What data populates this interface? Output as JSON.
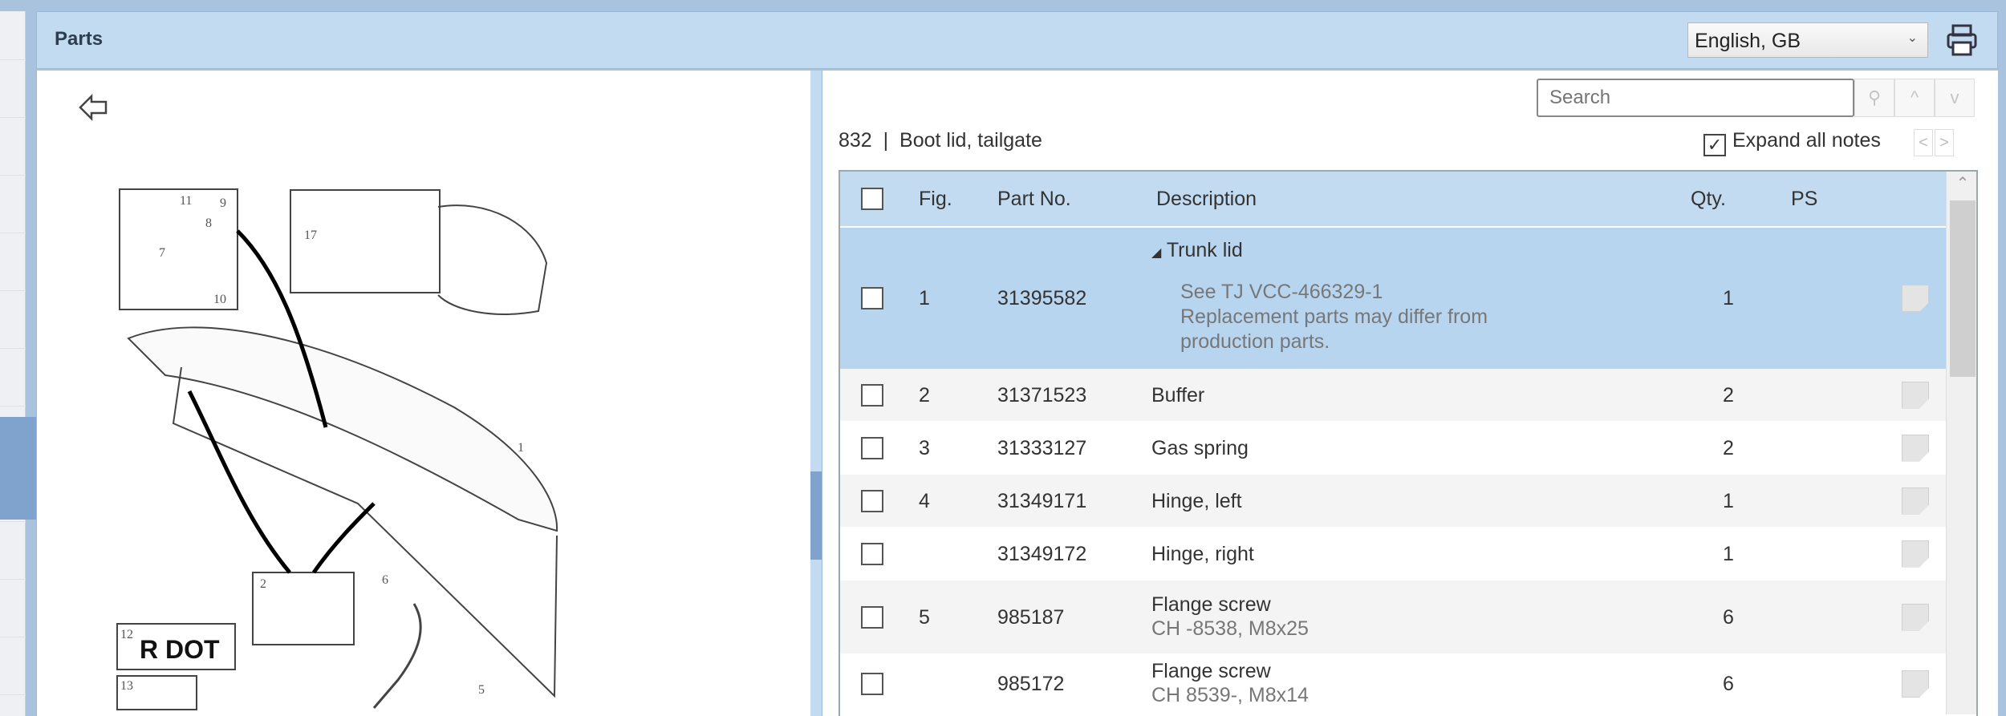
{
  "header": {
    "title": "Parts",
    "language": "English, GB",
    "print_icon": "printer-icon"
  },
  "diagram": {
    "callouts": [
      "11",
      "9",
      "8",
      "7",
      "10",
      "17",
      "1",
      "2",
      "6",
      "5",
      "12",
      "13"
    ],
    "label_logo": "R DOT"
  },
  "toolbar": {
    "search_placeholder": "Search",
    "up": "^",
    "down": "v",
    "prev": "<",
    "next": ">"
  },
  "section": {
    "number": "832",
    "separator": "|",
    "name": "Boot lid, tailgate"
  },
  "expand_notes": {
    "label": "Expand all notes",
    "checked": true,
    "check": "✓"
  },
  "table": {
    "columns": [
      "Fig.",
      "Part No.",
      "Description",
      "Qty.",
      "PS"
    ],
    "rows": [
      {
        "fig": "1",
        "part": "31395582",
        "desc": "Trunk lid",
        "notes": [
          "See TJ VCC-466329-1",
          "Replacement parts may differ from",
          "production parts."
        ],
        "qty": "1",
        "selected": true
      },
      {
        "fig": "2",
        "part": "31371523",
        "desc": "Buffer",
        "qty": "2"
      },
      {
        "fig": "3",
        "part": "31333127",
        "desc": "Gas spring",
        "qty": "2"
      },
      {
        "fig": "4",
        "part": "31349171",
        "desc": "Hinge, left",
        "qty": "1"
      },
      {
        "fig": "",
        "part": "31349172",
        "desc": "Hinge, right",
        "qty": "1"
      },
      {
        "fig": "5",
        "part": "985187",
        "desc": "Flange screw",
        "sub": "CH -8538, M8x25",
        "qty": "6"
      },
      {
        "fig": "",
        "part": "985172",
        "desc": "Flange screw",
        "sub": "CH 8539-, M8x14",
        "qty": "6"
      }
    ]
  },
  "colors": {
    "header_bg": "#c3dbf1",
    "selected_row": "#b8d5f0",
    "accent": "#7fa3cc"
  }
}
